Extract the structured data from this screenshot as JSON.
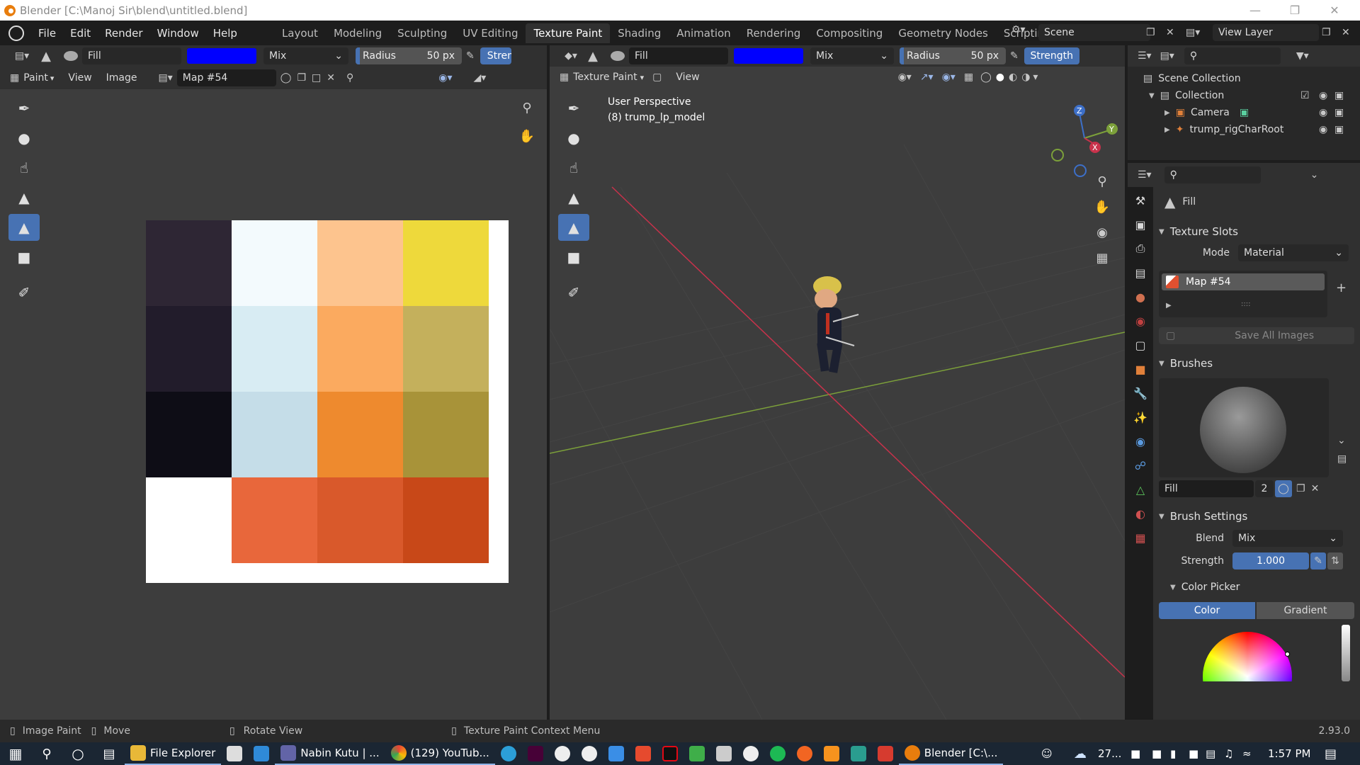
{
  "window": {
    "title": "Blender [C:\\Manoj Sir\\blend\\untitled.blend]"
  },
  "menu": {
    "items": [
      "File",
      "Edit",
      "Render",
      "Window",
      "Help"
    ]
  },
  "workspaces": {
    "tabs": [
      "Layout",
      "Modeling",
      "Sculpting",
      "UV Editing",
      "Texture Paint",
      "Shading",
      "Animation",
      "Rendering",
      "Compositing",
      "Geometry Nodes",
      "Scripting"
    ],
    "active": "Texture Paint",
    "add": "+"
  },
  "scene": {
    "label": "Scene"
  },
  "view_layer": {
    "label": "View Layer"
  },
  "image_editor": {
    "brush_name": "Fill",
    "color": "#0000ff",
    "blend": "Mix",
    "radius_label": "Radius",
    "radius_value": "50 px",
    "strength_label": "Stren",
    "mode": "Paint",
    "menus": [
      "View",
      "Image"
    ],
    "image_name": "Map #54"
  },
  "viewport": {
    "brush_name": "Fill",
    "color": "#0000ff",
    "blend": "Mix",
    "radius_label": "Radius",
    "radius_value": "50 px",
    "strength_label": "Strength",
    "mode": "Texture Paint",
    "view_menu": "View",
    "perspective": "User Perspective",
    "object": "(8) trump_lp_model",
    "gizmo": {
      "x": "X",
      "y": "Y",
      "z": "Z"
    }
  },
  "palette": {
    "rows": [
      [
        "#2e2634",
        "#f3fafd",
        "#fdc48e",
        "#eed93b"
      ],
      [
        "#221c2b",
        "#d8ecf3",
        "#fbaa5f",
        "#c4b05c"
      ],
      [
        "#0e0d16",
        "#c5dde8",
        "#ee8a2e",
        "#a89339"
      ],
      [
        "#ffffff",
        "#e8673b",
        "#d9592b",
        "#c84818"
      ]
    ]
  },
  "outliner": {
    "scene_collection": "Scene Collection",
    "collection": "Collection",
    "items": [
      "Camera",
      "trump_rigCharRoot"
    ]
  },
  "properties": {
    "brush_label": "Fill",
    "texture_slots": {
      "title": "Texture Slots",
      "mode_label": "Mode",
      "mode_value": "Material",
      "slot": "Map #54",
      "save_all": "Save All Images"
    },
    "brushes": {
      "title": "Brushes",
      "brush_name": "Fill",
      "users": "2"
    },
    "brush_settings": {
      "title": "Brush Settings",
      "blend_label": "Blend",
      "blend_value": "Mix",
      "strength_label": "Strength",
      "strength_value": "1.000"
    },
    "color_picker": {
      "title": "Color Picker",
      "tab_color": "Color",
      "tab_gradient": "Gradient"
    }
  },
  "statusbar": {
    "image_paint": "Image Paint",
    "move": "Move",
    "rotate": "Rotate View",
    "context": "Texture Paint Context Menu",
    "version": "2.93.0"
  },
  "taskbar": {
    "apps": [
      "File Explorer",
      "Nabin Kutu | ...",
      "(129) YouTub...",
      "Blender [C:\\..."
    ],
    "weather": "27...",
    "time": "1:57 PM"
  },
  "colors": {
    "accent": "#4772b3",
    "axis_x": "#c8324b",
    "axis_y": "#7ca03a"
  }
}
